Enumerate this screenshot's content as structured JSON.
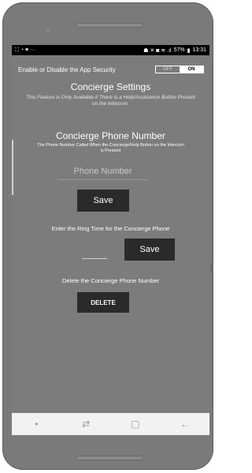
{
  "status_bar": {
    "left_icons": [
      "gallery-icon",
      "whatsapp-icon",
      "shield-icon",
      "more-notifications-icon"
    ],
    "left_glyphs": "⛶ ◔ ♥ ···",
    "right_glyphs": "☗ ✕ ◙ ≋ .ıl",
    "battery": "57%",
    "time": "13:31"
  },
  "security": {
    "label": "Enable or Disable the App Security",
    "toggle_off": "OFF",
    "toggle_on": "ON",
    "selected": "ON"
  },
  "concierge_settings": {
    "title": "Concierge Settings",
    "subtitle": "This Feature is Only Available if There is a Help/Assistance Button Present on the Intercom."
  },
  "phone_number": {
    "title": "Concierge Phone Number",
    "description": "The Phone Number Called When the Concierge/Help Button on the Intercom is Pressed",
    "placeholder": "Phone Number",
    "value": "",
    "save_label": "Save"
  },
  "ring_time": {
    "label": "Enter the Ring Time for the Concierge Phone",
    "value": "",
    "save_label": "Save"
  },
  "delete_section": {
    "label": "Delete the Concierge Phone Number",
    "button_label": "DELETE"
  },
  "nav_bar": {
    "dot": "•",
    "recent": "⇄",
    "home": "▢",
    "back": "←"
  },
  "colors": {
    "screen_bg": "#7c7c7c",
    "button_bg": "#2a2a2a",
    "input_underline": "#3fbfa3",
    "status_bar": "#000000"
  }
}
